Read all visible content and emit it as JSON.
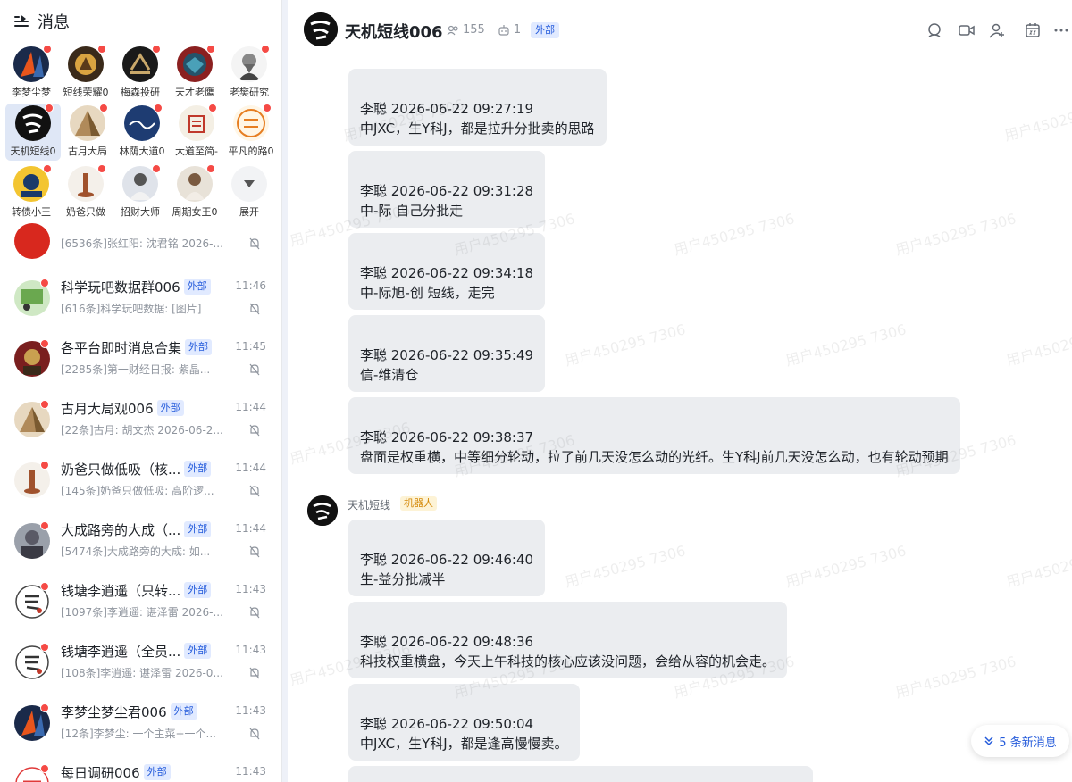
{
  "sidebar": {
    "title": "消息",
    "pinned": [
      {
        "label": "李梦尘梦",
        "color": "#1a2a4a",
        "accent": "#e8551c"
      },
      {
        "label": "短线荣耀0",
        "color": "#3a2a1a",
        "accent": "#d9a441"
      },
      {
        "label": "梅森投研",
        "color": "#1a1a1a",
        "accent": "#c9a86a"
      },
      {
        "label": "天才老鹰",
        "color": "#24536a",
        "accent": "#c33"
      },
      {
        "label": "老樊研究",
        "color": "#ffffff",
        "accent": "#444"
      },
      {
        "label": "天机短线0",
        "color": "#111111",
        "accent": "#fff"
      },
      {
        "label": "古月大局",
        "color": "#b08a5a",
        "accent": "#7a5a30"
      },
      {
        "label": "林荫大道0",
        "color": "#1e3c72",
        "accent": "#fff"
      },
      {
        "label": "大道至简-",
        "color": "#f4efe4",
        "accent": "#c0392b"
      },
      {
        "label": "平凡的路0",
        "color": "#fff6e6",
        "accent": "#e67e22"
      },
      {
        "label": "转债小王",
        "color": "#f3c531",
        "accent": "#1a3a6a"
      },
      {
        "label": "奶爸只做",
        "color": "#f4f0ea",
        "accent": "#a0522d"
      },
      {
        "label": "招财大师",
        "color": "#dfe3ea",
        "accent": "#555"
      },
      {
        "label": "周期女王0",
        "color": "#e8e2d8",
        "accent": "#7a5a40"
      },
      {
        "label": "展开",
        "color": "",
        "accent": ""
      }
    ],
    "chats": [
      {
        "name": "",
        "tag": "",
        "time": "",
        "preview": "[6536条]张红阳: 沈君铭 2026-...",
        "color": "#d8281e"
      },
      {
        "name": "科学玩吧数据群006",
        "tag": "外部",
        "time": "11:46",
        "preview": "[616条]科学玩吧数据: [图片]",
        "color": "#6aa84f"
      },
      {
        "name": "各平台即时消息合集",
        "tag": "外部",
        "time": "11:45",
        "preview": "[2285条]第一财经日报: 紫晶...",
        "color": "#7a1f1f"
      },
      {
        "name": "古月大局观006",
        "tag": "外部",
        "time": "11:44",
        "preview": "[22条]古月: 胡文杰 2026-06-2...",
        "color": "#b08a5a"
      },
      {
        "name": "奶爸只做低吸（核...",
        "tag": "外部",
        "time": "11:44",
        "preview": "[145条]奶爸只做低吸: 高阶逻...",
        "color": "#f4f0ea"
      },
      {
        "name": "大成路旁的大成（...",
        "tag": "外部",
        "time": "11:44",
        "preview": "[5474条]大成路旁的大成: 如...",
        "color": "#5a5a66"
      },
      {
        "name": "钱塘李逍遥（只转...",
        "tag": "外部",
        "time": "11:43",
        "preview": "[1097条]李逍遥: 谌泽雷 2026-...",
        "color": "#ffffff"
      },
      {
        "name": "钱塘李逍遥（全员...",
        "tag": "外部",
        "time": "11:43",
        "preview": "[108条]李逍遥: 谌泽雷 2026-0...",
        "color": "#ffffff"
      },
      {
        "name": "李梦尘梦尘君006",
        "tag": "外部",
        "time": "11:43",
        "preview": "[12条]李梦尘: 一个主菜+一个...",
        "color": "#1a2a4a"
      },
      {
        "name": "每日调研006",
        "tag": "外部",
        "time": "11:43",
        "preview": "",
        "color": "#ffffff"
      }
    ]
  },
  "chat": {
    "title": "天机短线006",
    "members": "155",
    "bots": "1",
    "tag": "外部",
    "bot_sender": "天机短线",
    "bot_tag": "机器人",
    "messages": [
      {
        "ts": "李聪 2026-06-22 09:27:19",
        "text": "中JXC，生Y科J，都是拉升分批卖的思路"
      },
      {
        "ts": "李聪 2026-06-22 09:31:28",
        "text": "中-际 自己分批走"
      },
      {
        "ts": "李聪 2026-06-22 09:34:18",
        "text": "中-际旭-创 短线，走完"
      },
      {
        "ts": "李聪 2026-06-22 09:35:49",
        "text": "信-维清仓"
      },
      {
        "ts": "李聪 2026-06-22 09:38:37",
        "text": "盘面是权重横，中等细分轮动，拉了前几天没怎么动的光纤。生Y科J前几天没怎么动，也有轮动预期"
      },
      {
        "ts": "李聪 2026-06-22 09:46:40",
        "text": "生-益分批减半"
      },
      {
        "ts": "李聪 2026-06-22 09:48:36",
        "text": "科技权重横盘，今天上午科技的核心应该没问题，会给从容的机会走。"
      },
      {
        "ts": "李聪 2026-06-22 09:50:04",
        "text": "中JXC，生Y科J，都是逢高慢慢卖。"
      }
    ],
    "watermark": "用户450295 7306",
    "new_messages": "5 条新消息"
  },
  "colors": {
    "badge": "#f54a45",
    "ext_tag_text": "#245bdb",
    "ext_tag_bg": "#e1eaff",
    "bubble_bg": "#ebedf0"
  }
}
